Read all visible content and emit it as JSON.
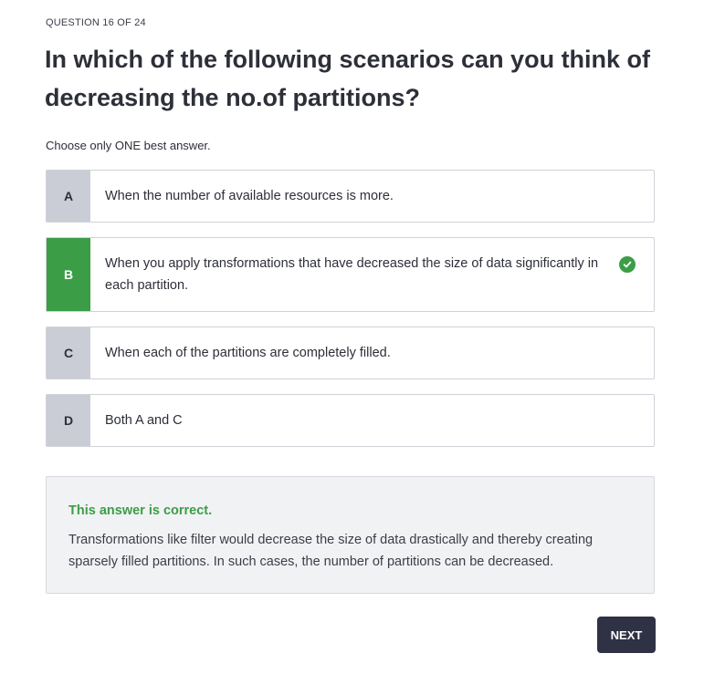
{
  "quiz": {
    "counter": "QUESTION 16 OF 24",
    "question": "In which of the following scenarios can you think of decreasing the no.of partitions?",
    "instruction": "Choose only ONE best answer.",
    "options": [
      {
        "letter": "A",
        "text": "When the number of available resources is more.",
        "selected": false
      },
      {
        "letter": "B",
        "text": "When you apply transformations that have decreased the size of data significantly in each partition.",
        "selected": true,
        "status_icon": "check-circle-icon"
      },
      {
        "letter": "C",
        "text": "When each of the partitions are completely filled.",
        "selected": false
      },
      {
        "letter": "D",
        "text": "Both A and C",
        "selected": false
      }
    ],
    "feedback": {
      "title": "This answer is correct.",
      "body": "Transformations like filter would decrease the size of data drastically and thereby creating sparsely filled partitions. In such cases, the number of partitions can be decreased."
    },
    "next_label": "NEXT"
  },
  "colors": {
    "correct": "#3c9d47",
    "letter_bg": "#cacdd6",
    "button_bg": "#2f3145",
    "feedback_bg": "#f1f2f4"
  }
}
